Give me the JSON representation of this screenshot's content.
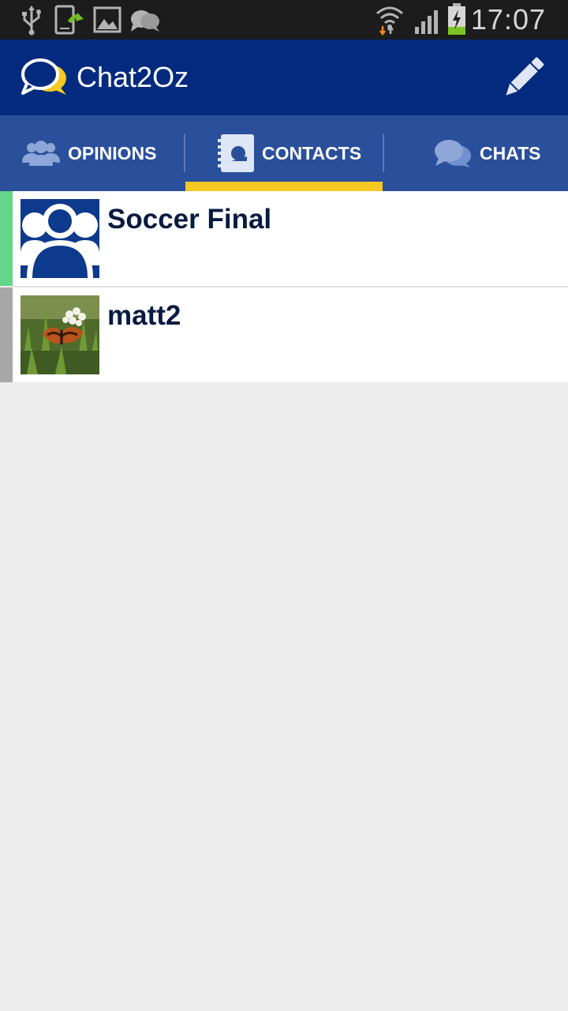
{
  "status_bar": {
    "time": "17:07",
    "left_icons": [
      "usb-icon",
      "app-update-icon",
      "gallery-icon",
      "chat-notification-icon"
    ],
    "right_icons": [
      "wifi-icon",
      "signal-icon",
      "battery-charging-icon"
    ]
  },
  "action_bar": {
    "title": "Chat2Oz",
    "logo_icon": "chat-bubbles-logo-icon",
    "compose_icon": "pencil-icon",
    "background": "#022a7e"
  },
  "tabs": [
    {
      "label": "OPINIONS",
      "icon": "people-icon",
      "selected": false
    },
    {
      "label": "CONTACTS",
      "icon": "contacts-book-icon",
      "selected": true
    },
    {
      "label": "CHATS",
      "icon": "chat-bubbles-icon",
      "selected": false
    }
  ],
  "tab_indicator_color": "#f5c823",
  "contacts": [
    {
      "name": "Soccer Final",
      "avatar": "group-icon",
      "status_color": "#63d68a"
    },
    {
      "name": "matt2",
      "avatar": "butterfly-photo",
      "status_color": "#a7a7a7"
    }
  ]
}
